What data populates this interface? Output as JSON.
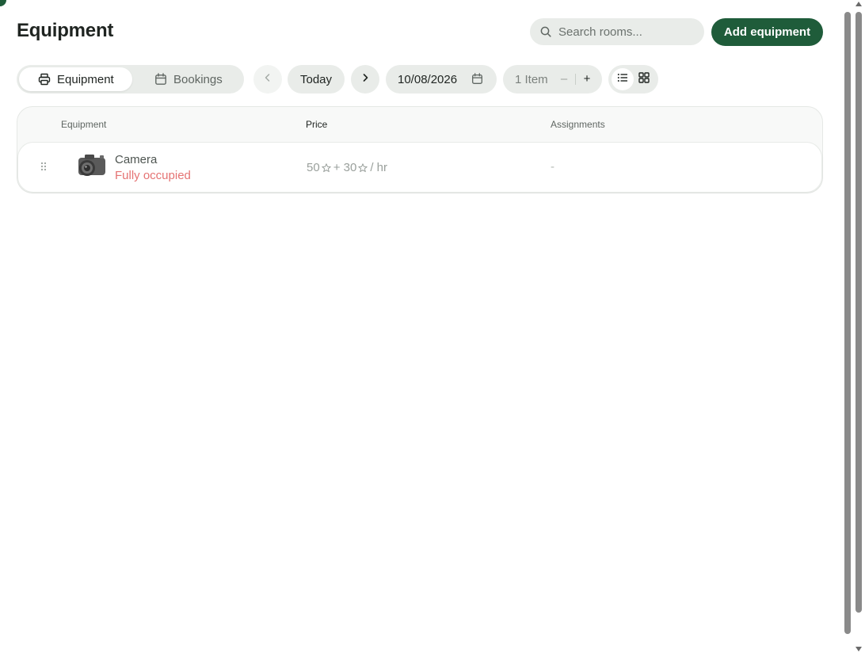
{
  "header": {
    "title": "Equipment",
    "search_placeholder": "Search rooms...",
    "add_button_label": "Add equipment"
  },
  "toolbar": {
    "tabs": [
      {
        "label": "Equipment",
        "icon": "printer-icon",
        "active": true
      },
      {
        "label": "Bookings",
        "icon": "calendar-icon",
        "active": false
      }
    ],
    "today_label": "Today",
    "date_value": "10/08/2026",
    "items_label": "1 Item",
    "minus_label": "–",
    "plus_label": "+",
    "view_modes": [
      "list",
      "grid"
    ],
    "active_view": "list"
  },
  "table": {
    "columns": [
      "Equipment",
      "Price",
      "Assignments"
    ],
    "rows": [
      {
        "name": "Camera",
        "status": "Fully occupied",
        "price_base": "50",
        "price_plus": "+ 30",
        "price_unit": "/ hr",
        "assignments": "-"
      }
    ]
  },
  "colors": {
    "primary": "#1f5c3a",
    "pill_bg": "#e9ece9",
    "status_occupied": "#e57373"
  }
}
